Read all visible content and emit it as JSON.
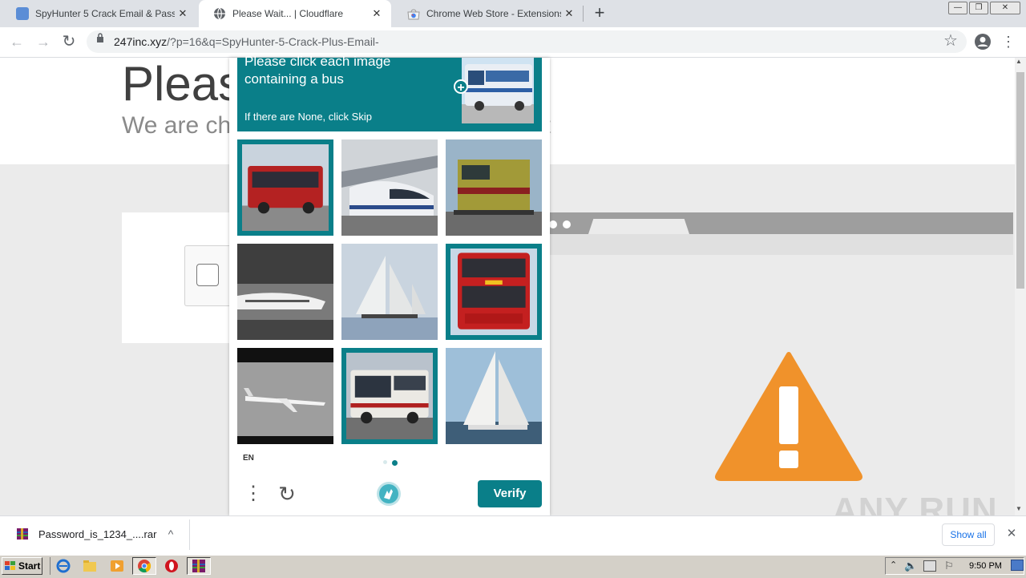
{
  "tabs": [
    {
      "title": "SpyHunter 5 Crack Email & Password",
      "close": "✕"
    },
    {
      "title": "Please Wait... | Cloudflare",
      "close": "✕"
    },
    {
      "title": "Chrome Web Store - Extensions",
      "close": "✕"
    }
  ],
  "new_tab": "+",
  "window_controls": {
    "minimize": "—",
    "restore": "❐",
    "close": "✕"
  },
  "toolbar": {
    "url_host": "247inc.xyz",
    "url_path": "/?p=16&q=SpyHunter-5-Crack-Plus-Email-",
    "back": "←",
    "forward": "→",
    "reload": "↻",
    "star": "☆",
    "menu": "⋮"
  },
  "page": {
    "heading": "Please Wait...",
    "heading_visible": "Pleas",
    "subheading_visible": "We are che",
    "subheading_tail": "t"
  },
  "captcha": {
    "prompt_line1": "Please click each image",
    "prompt_line2": "containing a bus",
    "hint": "If there are None, click Skip",
    "language": "EN",
    "verify_label": "Verify",
    "more_icon": "⋮",
    "refresh_icon": "↻",
    "accent": "#0a7f89",
    "images": [
      {
        "subject": "red bus",
        "selected": true
      },
      {
        "subject": "high speed train",
        "selected": false
      },
      {
        "subject": "locomotive",
        "selected": false
      },
      {
        "subject": "airplane on ground",
        "selected": false
      },
      {
        "subject": "sailboat",
        "selected": false
      },
      {
        "subject": "double decker bus",
        "selected": true
      },
      {
        "subject": "airplane in flight",
        "selected": false
      },
      {
        "subject": "white bus",
        "selected": true
      },
      {
        "subject": "sailboat",
        "selected": false
      }
    ]
  },
  "download": {
    "filename": "Password_is_1234_....rar",
    "show_all": "Show all",
    "close": "✕",
    "chevron": "^"
  },
  "taskbar": {
    "start": "Start",
    "clock": "9:50 PM"
  },
  "watermark": "ANY RUN",
  "warning_color": "#f0922b"
}
